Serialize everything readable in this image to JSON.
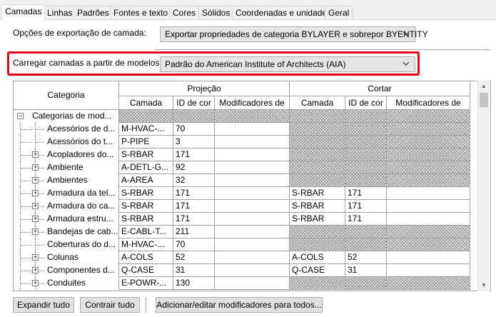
{
  "tabs": [
    {
      "label": "Camadas",
      "active": true
    },
    {
      "label": "Linhas"
    },
    {
      "label": "Padrões"
    },
    {
      "label": "Fontes e texto"
    },
    {
      "label": "Cores"
    },
    {
      "label": "Sólidos"
    },
    {
      "label": "Coordenadas e unidades"
    },
    {
      "label": "Geral"
    }
  ],
  "export_options": {
    "label": "Opções de exportação de camada:",
    "value": "Exportar propriedades de categoria BYLAYER e sobrepor BYENTITY"
  },
  "load_layers": {
    "label": "Carregar camadas a partir de modelos:",
    "value": "Padrão do American Institute of Architects (AIA)",
    "highlight_color": "#e3001b"
  },
  "grid": {
    "header": {
      "category": "Categoria",
      "projection": "Projeção",
      "cut": "Cortar",
      "layer": "Camada",
      "color_id": "ID de cor",
      "modifiers": "Modificadores de"
    },
    "rows": [
      {
        "category": "Categorias de mod...",
        "proj_layer": "",
        "proj_color": "",
        "proj_hatched": true,
        "cut_layer": "",
        "cut_color": "",
        "cut_hatched": true,
        "root": true
      },
      {
        "category": "Acessórios de d...",
        "proj_layer": "M-HVAC-...",
        "proj_color": "70",
        "proj_hatched": false,
        "cut_layer": "",
        "cut_color": "",
        "cut_hatched": true,
        "expandable": false
      },
      {
        "category": "Acessórios do t...",
        "proj_layer": "P-PIPE",
        "proj_color": "3",
        "proj_hatched": false,
        "cut_layer": "",
        "cut_color": "",
        "cut_hatched": true,
        "expandable": false
      },
      {
        "category": "Acopladores do...",
        "proj_layer": "S-RBAR",
        "proj_color": "171",
        "proj_hatched": false,
        "cut_layer": "",
        "cut_color": "",
        "cut_hatched": true,
        "expandable": true
      },
      {
        "category": "Ambiente",
        "proj_layer": "A-DETL-G...",
        "proj_color": "92",
        "proj_hatched": false,
        "cut_layer": "",
        "cut_color": "",
        "cut_hatched": true,
        "expandable": true
      },
      {
        "category": "Ambientes",
        "proj_layer": "A-AREA",
        "proj_color": "32",
        "proj_hatched": false,
        "cut_layer": "",
        "cut_color": "",
        "cut_hatched": true,
        "expandable": true
      },
      {
        "category": "Armadura da tel...",
        "proj_layer": "S-RBAR",
        "proj_color": "171",
        "proj_hatched": false,
        "cut_layer": "S-RBAR",
        "cut_color": "171",
        "cut_hatched": false,
        "expandable": true
      },
      {
        "category": "Armadura do ca...",
        "proj_layer": "S-RBAR",
        "proj_color": "171",
        "proj_hatched": false,
        "cut_layer": "S-RBAR",
        "cut_color": "171",
        "cut_hatched": false,
        "expandable": true
      },
      {
        "category": "Armadura estru...",
        "proj_layer": "S-RBAR",
        "proj_color": "171",
        "proj_hatched": false,
        "cut_layer": "S-RBAR",
        "cut_color": "171",
        "cut_hatched": false,
        "expandable": true
      },
      {
        "category": "Bandejas de cab...",
        "proj_layer": "E-CABL-T...",
        "proj_color": "211",
        "proj_hatched": false,
        "cut_layer": "",
        "cut_color": "",
        "cut_hatched": true,
        "expandable": true
      },
      {
        "category": "Coberturas do d...",
        "proj_layer": "M-HVAC-...",
        "proj_color": "70",
        "proj_hatched": false,
        "cut_layer": "",
        "cut_color": "",
        "cut_hatched": true,
        "expandable": false
      },
      {
        "category": "Colunas",
        "proj_layer": "A-COLS",
        "proj_color": "52",
        "proj_hatched": false,
        "cut_layer": "A-COLS",
        "cut_color": "52",
        "cut_hatched": false,
        "expandable": true
      },
      {
        "category": "Componentes d...",
        "proj_layer": "Q-CASE",
        "proj_color": "31",
        "proj_hatched": false,
        "cut_layer": "Q-CASE",
        "cut_color": "31",
        "cut_hatched": false,
        "expandable": true
      },
      {
        "category": "Conduites",
        "proj_layer": "E-POWR-...",
        "proj_color": "130",
        "proj_hatched": false,
        "cut_layer": "",
        "cut_color": "",
        "cut_hatched": true,
        "expandable": true
      }
    ]
  },
  "buttons": {
    "expand_all": "Expandir tudo",
    "collapse_all": "Contrair tudo",
    "add_edit_modifiers": "Adicionar/editar modificadores para todos..."
  }
}
